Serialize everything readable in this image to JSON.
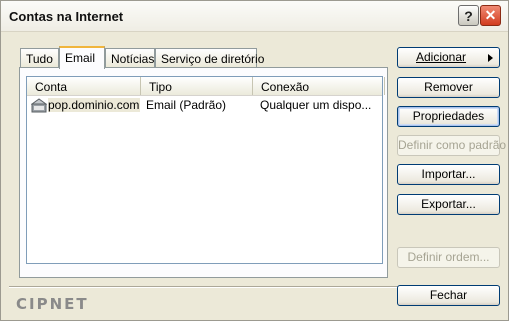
{
  "window": {
    "title": "Contas na Internet"
  },
  "titlebar": {
    "help_glyph": "?",
    "close_glyph": "✕"
  },
  "tabs": [
    {
      "label": "Tudo"
    },
    {
      "label": "Email"
    },
    {
      "label": "Notícias"
    },
    {
      "label": "Serviço de diretório"
    }
  ],
  "active_tab": "Email",
  "listview": {
    "columns": [
      "Conta",
      "Tipo",
      "Conexão"
    ],
    "rows": [
      {
        "conta": "pop.dominio.com...",
        "tipo": "Email (Padrão)",
        "conexao": "Qualquer um dispo..."
      }
    ]
  },
  "buttons": {
    "adicionar": "Adicionar",
    "remover": "Remover",
    "propriedades": "Propriedades",
    "definir_padrao": "Definir como padrão",
    "importar": "Importar...",
    "exportar": "Exportar...",
    "definir_ordem": "Definir ordem...",
    "fechar": "Fechar"
  },
  "brand": "CIPNET",
  "icons": {
    "account": "mail-account-icon",
    "submenu": "arrow-right-icon"
  }
}
